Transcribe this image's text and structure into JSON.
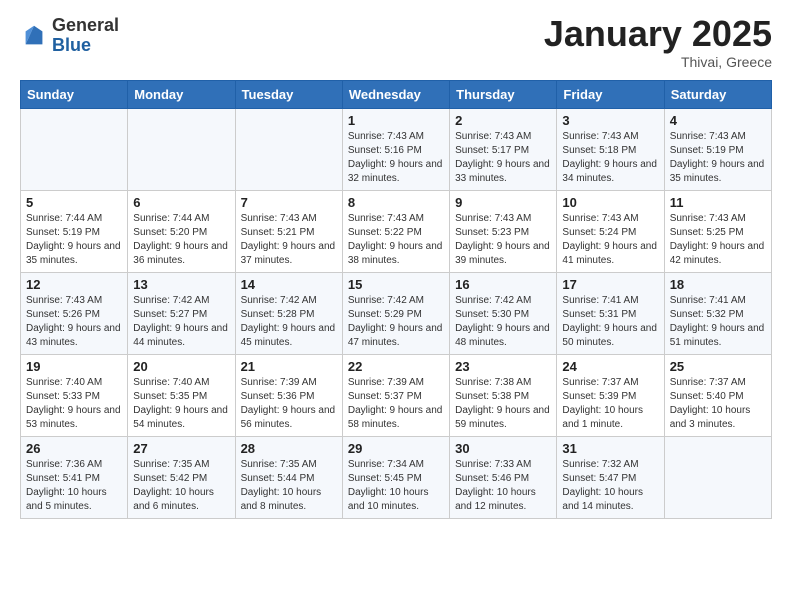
{
  "logo": {
    "general": "General",
    "blue": "Blue"
  },
  "title": "January 2025",
  "subtitle": "Thivai, Greece",
  "days_of_week": [
    "Sunday",
    "Monday",
    "Tuesday",
    "Wednesday",
    "Thursday",
    "Friday",
    "Saturday"
  ],
  "weeks": [
    [
      {
        "day": "",
        "detail": ""
      },
      {
        "day": "",
        "detail": ""
      },
      {
        "day": "",
        "detail": ""
      },
      {
        "day": "1",
        "detail": "Sunrise: 7:43 AM\nSunset: 5:16 PM\nDaylight: 9 hours and 32 minutes."
      },
      {
        "day": "2",
        "detail": "Sunrise: 7:43 AM\nSunset: 5:17 PM\nDaylight: 9 hours and 33 minutes."
      },
      {
        "day": "3",
        "detail": "Sunrise: 7:43 AM\nSunset: 5:18 PM\nDaylight: 9 hours and 34 minutes."
      },
      {
        "day": "4",
        "detail": "Sunrise: 7:43 AM\nSunset: 5:19 PM\nDaylight: 9 hours and 35 minutes."
      }
    ],
    [
      {
        "day": "5",
        "detail": "Sunrise: 7:44 AM\nSunset: 5:19 PM\nDaylight: 9 hours and 35 minutes."
      },
      {
        "day": "6",
        "detail": "Sunrise: 7:44 AM\nSunset: 5:20 PM\nDaylight: 9 hours and 36 minutes."
      },
      {
        "day": "7",
        "detail": "Sunrise: 7:43 AM\nSunset: 5:21 PM\nDaylight: 9 hours and 37 minutes."
      },
      {
        "day": "8",
        "detail": "Sunrise: 7:43 AM\nSunset: 5:22 PM\nDaylight: 9 hours and 38 minutes."
      },
      {
        "day": "9",
        "detail": "Sunrise: 7:43 AM\nSunset: 5:23 PM\nDaylight: 9 hours and 39 minutes."
      },
      {
        "day": "10",
        "detail": "Sunrise: 7:43 AM\nSunset: 5:24 PM\nDaylight: 9 hours and 41 minutes."
      },
      {
        "day": "11",
        "detail": "Sunrise: 7:43 AM\nSunset: 5:25 PM\nDaylight: 9 hours and 42 minutes."
      }
    ],
    [
      {
        "day": "12",
        "detail": "Sunrise: 7:43 AM\nSunset: 5:26 PM\nDaylight: 9 hours and 43 minutes."
      },
      {
        "day": "13",
        "detail": "Sunrise: 7:42 AM\nSunset: 5:27 PM\nDaylight: 9 hours and 44 minutes."
      },
      {
        "day": "14",
        "detail": "Sunrise: 7:42 AM\nSunset: 5:28 PM\nDaylight: 9 hours and 45 minutes."
      },
      {
        "day": "15",
        "detail": "Sunrise: 7:42 AM\nSunset: 5:29 PM\nDaylight: 9 hours and 47 minutes."
      },
      {
        "day": "16",
        "detail": "Sunrise: 7:42 AM\nSunset: 5:30 PM\nDaylight: 9 hours and 48 minutes."
      },
      {
        "day": "17",
        "detail": "Sunrise: 7:41 AM\nSunset: 5:31 PM\nDaylight: 9 hours and 50 minutes."
      },
      {
        "day": "18",
        "detail": "Sunrise: 7:41 AM\nSunset: 5:32 PM\nDaylight: 9 hours and 51 minutes."
      }
    ],
    [
      {
        "day": "19",
        "detail": "Sunrise: 7:40 AM\nSunset: 5:33 PM\nDaylight: 9 hours and 53 minutes."
      },
      {
        "day": "20",
        "detail": "Sunrise: 7:40 AM\nSunset: 5:35 PM\nDaylight: 9 hours and 54 minutes."
      },
      {
        "day": "21",
        "detail": "Sunrise: 7:39 AM\nSunset: 5:36 PM\nDaylight: 9 hours and 56 minutes."
      },
      {
        "day": "22",
        "detail": "Sunrise: 7:39 AM\nSunset: 5:37 PM\nDaylight: 9 hours and 58 minutes."
      },
      {
        "day": "23",
        "detail": "Sunrise: 7:38 AM\nSunset: 5:38 PM\nDaylight: 9 hours and 59 minutes."
      },
      {
        "day": "24",
        "detail": "Sunrise: 7:37 AM\nSunset: 5:39 PM\nDaylight: 10 hours and 1 minute."
      },
      {
        "day": "25",
        "detail": "Sunrise: 7:37 AM\nSunset: 5:40 PM\nDaylight: 10 hours and 3 minutes."
      }
    ],
    [
      {
        "day": "26",
        "detail": "Sunrise: 7:36 AM\nSunset: 5:41 PM\nDaylight: 10 hours and 5 minutes."
      },
      {
        "day": "27",
        "detail": "Sunrise: 7:35 AM\nSunset: 5:42 PM\nDaylight: 10 hours and 6 minutes."
      },
      {
        "day": "28",
        "detail": "Sunrise: 7:35 AM\nSunset: 5:44 PM\nDaylight: 10 hours and 8 minutes."
      },
      {
        "day": "29",
        "detail": "Sunrise: 7:34 AM\nSunset: 5:45 PM\nDaylight: 10 hours and 10 minutes."
      },
      {
        "day": "30",
        "detail": "Sunrise: 7:33 AM\nSunset: 5:46 PM\nDaylight: 10 hours and 12 minutes."
      },
      {
        "day": "31",
        "detail": "Sunrise: 7:32 AM\nSunset: 5:47 PM\nDaylight: 10 hours and 14 minutes."
      },
      {
        "day": "",
        "detail": ""
      }
    ]
  ]
}
